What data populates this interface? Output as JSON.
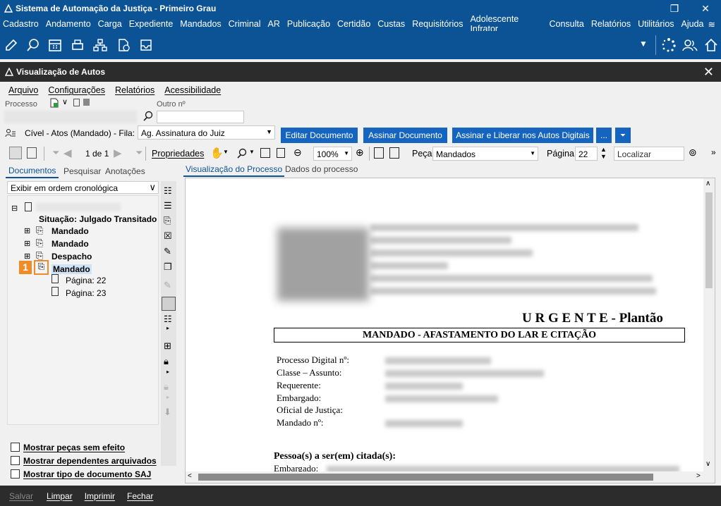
{
  "app": {
    "title": "Sistema de Automação da Justiça - Primeiro Grau",
    "menu": [
      "Cadastro",
      "Andamento",
      "Carga",
      "Expediente",
      "Mandados",
      "Criminal",
      "AR",
      "Publicação",
      "Certidão",
      "Custas",
      "Requisitórios",
      "Adolescente Infrator",
      "Consulta",
      "Relatórios",
      "Utilitários",
      "Ajuda"
    ]
  },
  "window": {
    "title": "Visualização de Autos",
    "menu": [
      "Arquivo",
      "Configurações",
      "Relatórios",
      "Acessibilidade"
    ]
  },
  "process": {
    "processo_label": "Processo",
    "outro_label": "Outro nº",
    "fila_label": "Cível - Atos (Mandado) - Fila:",
    "fila_value": "Ag. Assinatura do Juiz",
    "buttons": [
      "Editar Documento",
      "Assinar Documento",
      "Assinar e Liberar nos Autos Digitais",
      "..."
    ]
  },
  "viewer_toolbar": {
    "page_nav": "1 de 1",
    "properties": "Propriedades",
    "zoom": "100%",
    "peca_label": "Peça",
    "peca_value": "Mandados",
    "pagina_label": "Página",
    "pagina_value": "22",
    "localizar_placeholder": "Localizar"
  },
  "left": {
    "tabs": [
      "Documentos",
      "Pesquisar",
      "Anotações"
    ],
    "order": "Exibir em ordem cronológica",
    "situacao": "Situação: Julgado Transitado",
    "items": [
      "Mandado",
      "Mandado",
      "Despacho",
      "Mandado"
    ],
    "pages": [
      "Página: 22",
      "Página: 23"
    ],
    "badge": "1",
    "checkboxes": [
      "Mostrar peças sem efeito",
      "Mostrar dependentes arquivados",
      "Mostrar tipo de documento SAJ"
    ]
  },
  "doc_tabs": [
    "Visualização do Processo",
    "Dados do processo"
  ],
  "document": {
    "urgent": "U R G E N T E -  Plantão",
    "heading": "MANDADO - AFASTAMENTO DO LAR E CITAÇÃO",
    "fields": [
      "Processo Digital nº:",
      "Classe – Assunto:",
      "Requerente:",
      "Embargado:",
      "Oficial de Justiça:",
      "Mandado nº:"
    ],
    "section": "Pessoa(s) a ser(em) citada(s):",
    "section_line": "Embargado:"
  },
  "bottom": [
    "Salvar",
    "Limpar",
    "Imprimir",
    "Fechar"
  ],
  "colors": {
    "brand": "#0b5394",
    "dark": "#2c2c2c",
    "badge": "#f08c28",
    "button": "#1565c0"
  }
}
